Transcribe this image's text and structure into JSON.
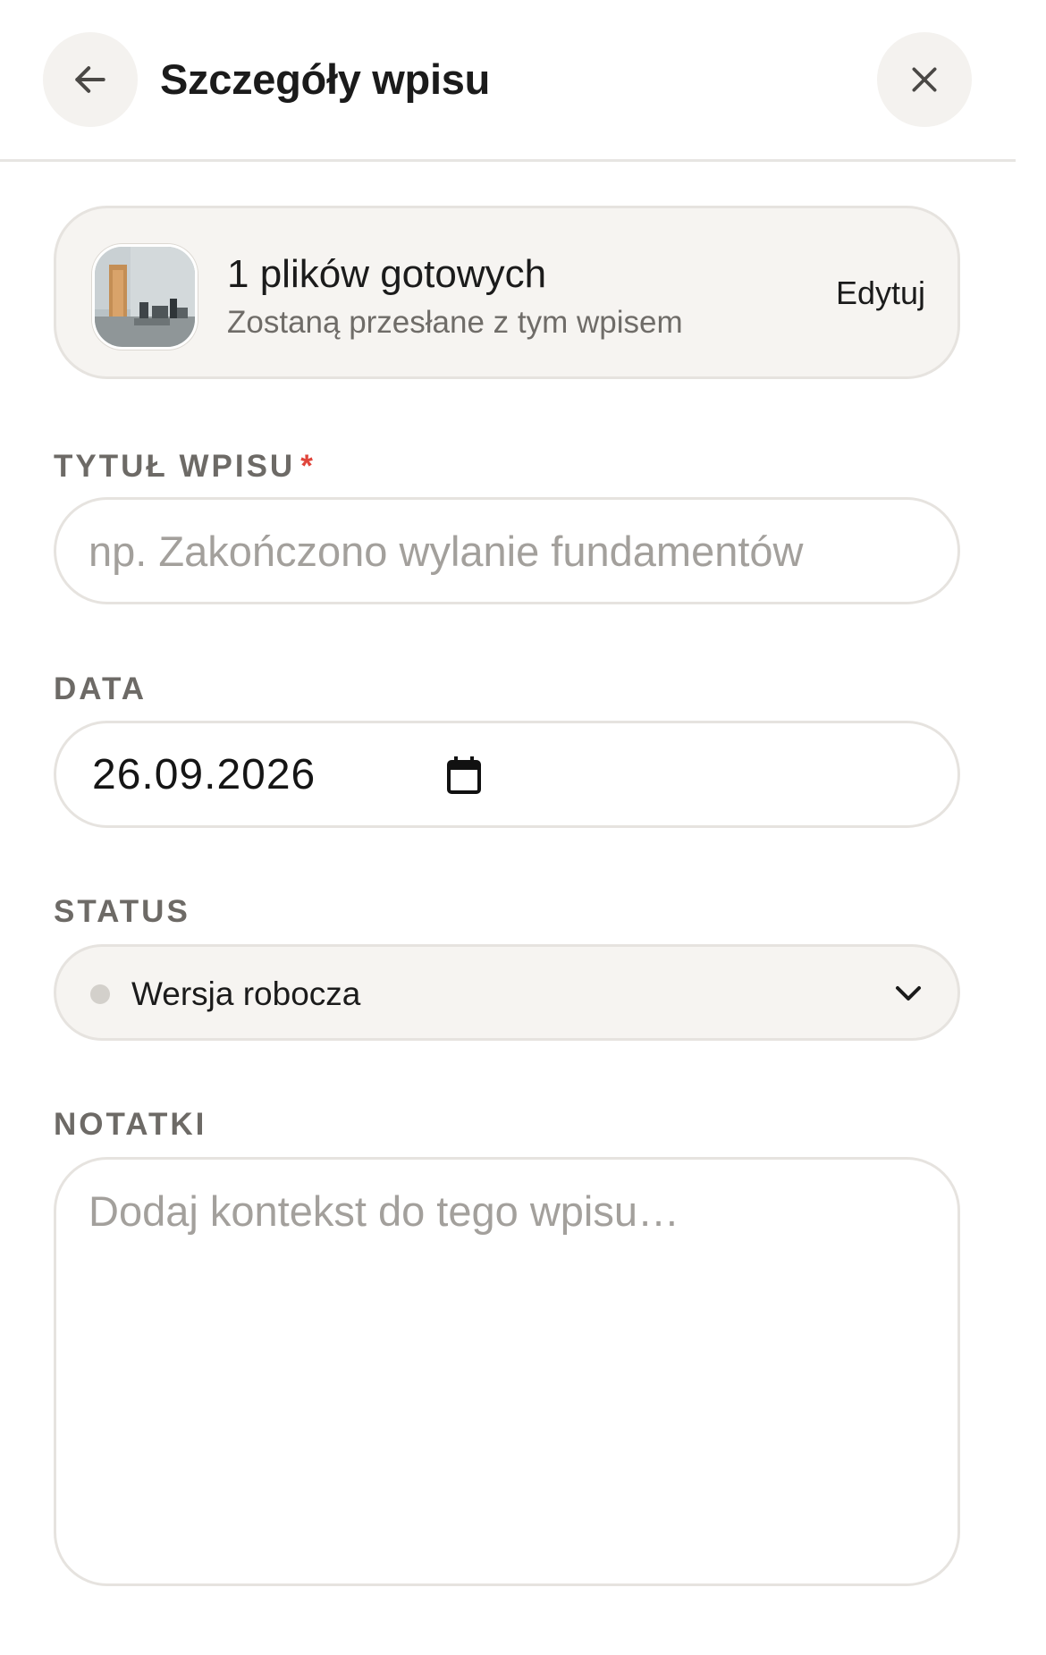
{
  "header": {
    "title": "Szczegóły wpisu",
    "back_icon": "arrow-left-icon",
    "close_icon": "close-icon"
  },
  "files": {
    "count_text": "1 plików gotowych",
    "subtitle": "Zostaną przesłane z tym wpisem",
    "edit_label": "Edytuj",
    "thumbnail_icon": "photo-thumbnail"
  },
  "form": {
    "title": {
      "label": "TYTUŁ WPISU",
      "required_mark": "*",
      "value": "",
      "placeholder": "np. Zakończono wylanie fundamentów"
    },
    "date": {
      "label": "DATA",
      "value": "26.09.2026",
      "icon": "calendar-icon"
    },
    "status": {
      "label": "STATUS",
      "value": "Wersja robocza",
      "dot_color": "#d3d0cb",
      "icon": "chevron-down-icon"
    },
    "notes": {
      "label": "NOTATKI",
      "value": "",
      "placeholder": "Dodaj kontekst do tego wpisu…"
    }
  },
  "colors": {
    "accent_required": "#e0453b",
    "card_background": "#f6f4f1",
    "border": "#e6e3df",
    "label_text": "#6d6a66"
  }
}
